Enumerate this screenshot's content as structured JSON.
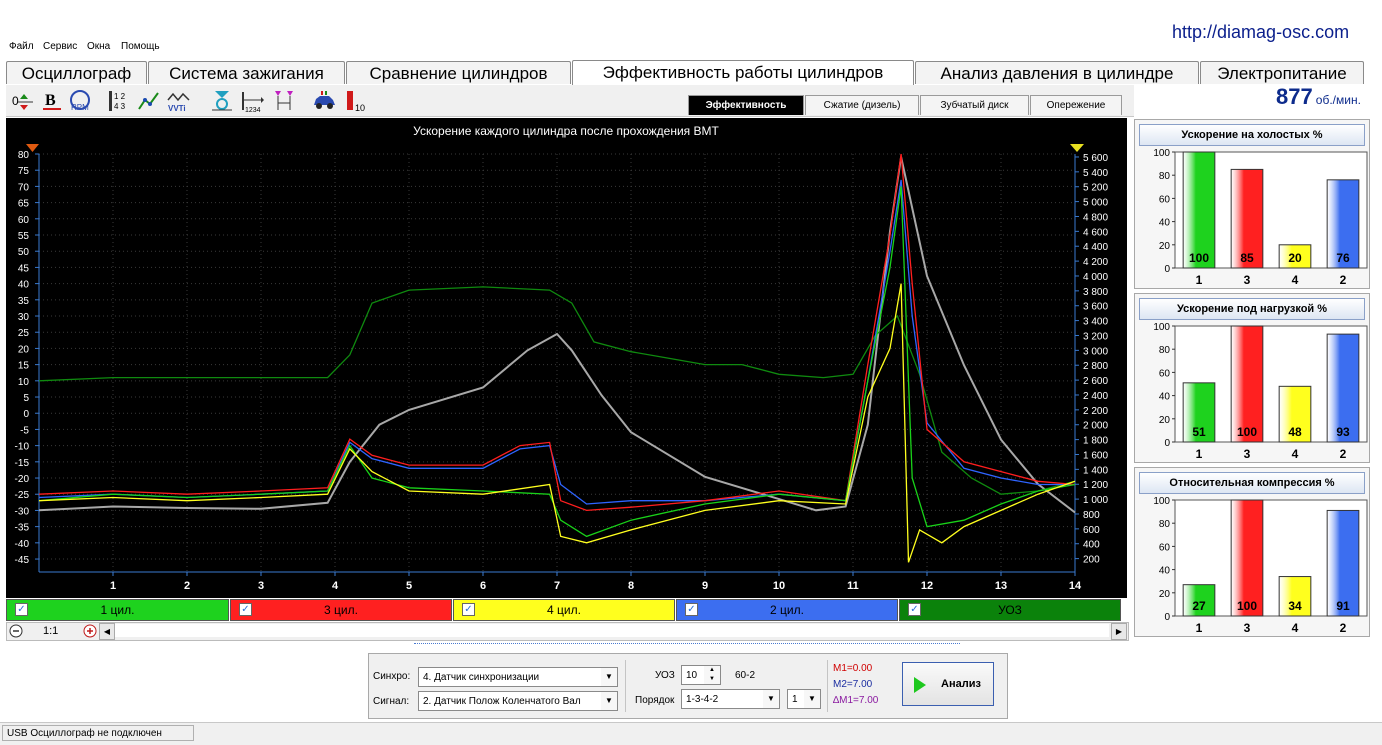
{
  "app": {
    "url": "http://diamag-osc.com"
  },
  "menu": [
    "Файл",
    "Сервис",
    "Окна",
    "Помощь"
  ],
  "tabs": [
    "Осциллограф",
    "Система зажигания",
    "Сравнение цилиндров",
    "Эффективность работы цилиндров",
    "Анализ давления в цилиндре",
    "Электропитание"
  ],
  "active_tab": "Эффективность работы цилиндров",
  "toolbar_icons": [
    "axis-offset-icon",
    "bold-icon",
    "rpm-icon",
    "numbering-icon",
    "line-chart-icon",
    "vvti-icon",
    "sync-marker-icon",
    "cylinder-order-icon",
    "range-marker-icon",
    "car-icon",
    "bar-scale-icon"
  ],
  "subtabs": [
    "Эффективность",
    "Сжатие (дизель)",
    "Зубчатый диск",
    "Опережение"
  ],
  "active_subtab": "Эффективность",
  "rpm": {
    "value": "877",
    "unit": "об./мин."
  },
  "chart_data": {
    "type": "line",
    "title": "Ускорение каждого цилиндра после прохождения ВМТ",
    "xlabel": "",
    "ylabel": "",
    "x_ticks": [
      "1",
      "2",
      "3",
      "4",
      "5",
      "6",
      "7",
      "8",
      "9",
      "10",
      "11",
      "12",
      "13",
      "14"
    ],
    "xlim": [
      0,
      14
    ],
    "y_left_ticks": [
      "80",
      "75",
      "70",
      "65",
      "60",
      "55",
      "50",
      "45",
      "40",
      "35",
      "30",
      "25",
      "20",
      "15",
      "10",
      "5",
      "0",
      "-5",
      "-10",
      "-15",
      "-20",
      "-25",
      "-30",
      "-35",
      "-40",
      "-45"
    ],
    "ylim_left": [
      -49,
      80
    ],
    "y_right_ticks": [
      "5 600",
      "5 400",
      "5 200",
      "5 000",
      "4 800",
      "4 600",
      "4 400",
      "4 200",
      "4 000",
      "3 800",
      "3 600",
      "3 400",
      "3 200",
      "3 000",
      "2 800",
      "2 600",
      "2 400",
      "2 200",
      "2 000",
      "1 800",
      "1 600",
      "1 400",
      "1 200",
      "1 000",
      "800",
      "600",
      "400",
      "200"
    ],
    "ylim_right": [
      20,
      5640
    ],
    "background": "#000000",
    "grid": true,
    "series": [
      {
        "name": "1 цил.",
        "color": "#19d219",
        "axis": "left",
        "x": [
          0,
          1,
          2,
          3,
          3.9,
          4.2,
          4.5,
          5,
          6,
          6.9,
          7.05,
          7.4,
          8,
          9,
          10,
          10.9,
          11.2,
          11.5,
          11.65,
          11.8,
          12,
          12.5,
          13,
          13.5,
          14
        ],
        "y": [
          -27,
          -25,
          -26,
          -25,
          -24,
          -10,
          -20,
          -23,
          -24,
          -25,
          -33,
          -38,
          -33,
          -28,
          -25,
          -27,
          10,
          45,
          70,
          -20,
          -35,
          -33,
          -28,
          -24,
          -22
        ]
      },
      {
        "name": "3 цил.",
        "color": "#ff1e1e",
        "axis": "left",
        "x": [
          0,
          1,
          2,
          3,
          3.9,
          4.2,
          4.5,
          5,
          6,
          6.5,
          6.9,
          7.05,
          7.4,
          8,
          9,
          10,
          10.9,
          11.2,
          11.5,
          11.65,
          11.8,
          12,
          12.5,
          13,
          13.5,
          14
        ],
        "y": [
          -25,
          -24,
          -25,
          -24,
          -23,
          -8,
          -13,
          -16,
          -16,
          -10,
          -9,
          -27,
          -30,
          -29,
          -27,
          -24,
          -27,
          15,
          55,
          80,
          40,
          -5,
          -15,
          -18,
          -21,
          -22
        ]
      },
      {
        "name": "4 цил.",
        "color": "#ffff1e",
        "axis": "left",
        "x": [
          0,
          1,
          2,
          3,
          3.9,
          4.2,
          4.5,
          5,
          6,
          6.9,
          7.05,
          7.4,
          8,
          9,
          10,
          10.9,
          11.2,
          11.5,
          11.65,
          11.75,
          11.9,
          12.2,
          12.5,
          13,
          13.5,
          14
        ],
        "y": [
          -27,
          -26,
          -27,
          -26,
          -25,
          -11,
          -18,
          -24,
          -25,
          -22,
          -38,
          -40,
          -36,
          -30,
          -27,
          -28,
          5,
          20,
          40,
          -46,
          -36,
          -40,
          -35,
          -30,
          -25,
          -21
        ]
      },
      {
        "name": "2 цил.",
        "color": "#2e64ff",
        "axis": "left",
        "x": [
          0,
          1,
          2,
          3,
          3.9,
          4.2,
          4.5,
          5,
          6,
          6.5,
          6.9,
          7.05,
          7.4,
          8,
          9,
          10,
          10.9,
          11.2,
          11.5,
          11.65,
          11.8,
          12,
          12.5,
          13,
          13.5,
          14
        ],
        "y": [
          -26,
          -25,
          -26,
          -25,
          -24,
          -9,
          -14,
          -17,
          -17,
          -11,
          -10,
          -22,
          -28,
          -27,
          -27,
          -25,
          -27,
          10,
          50,
          72,
          30,
          -3,
          -17,
          -20,
          -22,
          -22
        ]
      },
      {
        "name": "УОЗ",
        "color": "#0f8a0f",
        "axis": "left",
        "x": [
          0,
          1,
          2,
          3,
          3.9,
          4.2,
          4.5,
          5,
          6,
          6.9,
          7.2,
          7.5,
          8,
          8.5,
          9,
          9.5,
          10,
          10.6,
          11,
          11.3,
          11.6,
          11.9,
          12.2,
          12.6,
          13,
          13.5,
          14
        ],
        "y": [
          10,
          11,
          11,
          11,
          11,
          18,
          34,
          38,
          39,
          38,
          34,
          22,
          19,
          17,
          15,
          15,
          12,
          11,
          12,
          24,
          30,
          12,
          -12,
          -20,
          -25,
          -24,
          -21
        ]
      },
      {
        "name": "",
        "color": "#a8a8a8",
        "axis": "right",
        "x": [
          0,
          1,
          2,
          3,
          3.9,
          4.2,
          4.6,
          5,
          6,
          6.6,
          7,
          7.2,
          7.6,
          8,
          9,
          10,
          10.5,
          10.9,
          11.2,
          11.5,
          11.65,
          12,
          12.5,
          13,
          13.5,
          14
        ],
        "y": [
          850,
          900,
          880,
          870,
          950,
          1500,
          2000,
          2200,
          2500,
          3000,
          3220,
          3000,
          2400,
          1900,
          1300,
          1000,
          850,
          900,
          2000,
          4600,
          5600,
          4000,
          2800,
          1800,
          1200,
          820
        ]
      }
    ]
  },
  "legend_items": [
    {
      "label": "1 цил.",
      "color": "#1ed21e",
      "checked": true
    },
    {
      "label": "3 цил.",
      "color": "#ff2020",
      "checked": true
    },
    {
      "label": "4 цил.",
      "color": "#ffff1e",
      "checked": true
    },
    {
      "label": "2 цил.",
      "color": "#3c6ef0",
      "checked": true
    },
    {
      "label": "УОЗ",
      "color": "#0b820b",
      "checked": true
    }
  ],
  "zoom": {
    "label": "1:1"
  },
  "side_charts": [
    {
      "title": "Ускорение на холостых %",
      "type": "bar",
      "categories": [
        "1",
        "3",
        "4",
        "2"
      ],
      "values": [
        100,
        85,
        20,
        76
      ],
      "colors": [
        "#1ed21e",
        "#ff2020",
        "#ffff1e",
        "#3c6ef0"
      ],
      "y_ticks": [
        "100",
        "80",
        "60",
        "40",
        "20",
        "0"
      ],
      "ylim": [
        0,
        100
      ]
    },
    {
      "title": "Ускорение под нагрузкой %",
      "type": "bar",
      "categories": [
        "1",
        "3",
        "4",
        "2"
      ],
      "values": [
        51,
        100,
        48,
        93
      ],
      "colors": [
        "#1ed21e",
        "#ff2020",
        "#ffff1e",
        "#3c6ef0"
      ],
      "y_ticks": [
        "100",
        "80",
        "60",
        "40",
        "20",
        "0"
      ],
      "ylim": [
        0,
        100
      ]
    },
    {
      "title": "Относительная компрессия %",
      "type": "bar",
      "categories": [
        "1",
        "3",
        "4",
        "2"
      ],
      "values": [
        27,
        100,
        34,
        91
      ],
      "colors": [
        "#1ed21e",
        "#ff2020",
        "#ffff1e",
        "#3c6ef0"
      ],
      "y_ticks": [
        "100",
        "80",
        "60",
        "40",
        "20",
        "0"
      ],
      "ylim": [
        0,
        100
      ]
    }
  ],
  "controls": {
    "sync_label": "Синхро:",
    "sync_value": "4.  Датчик синхронизации",
    "signal_label": "Сигнал:",
    "signal_value": "2.  Датчик Полож Коленчатого Вал",
    "uoz_label": "УОЗ",
    "uoz_value": "10",
    "wheel_value": "60-2",
    "order_label": "Порядок",
    "order_value": "1-3-4-2",
    "order_num": "1",
    "m1": "M1=0.00",
    "m2": "M2=7.00",
    "dm1": "∆M1=7.00",
    "m1_color": "#d00000",
    "m2_color": "#1a2ca0",
    "dm1_color": "#8a1aa0",
    "analyze_label": "Анализ"
  },
  "status": {
    "text": "USB Осциллограф не подключен"
  }
}
